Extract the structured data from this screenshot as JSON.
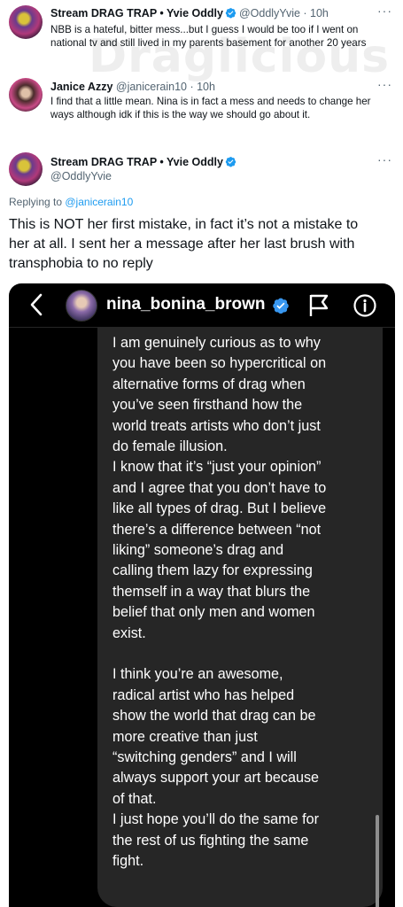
{
  "watermark": "Draglicious",
  "tweet1": {
    "name": "Stream DRAG TRAP • Yvie Oddly",
    "handle": "@OddlyYvie · 10h",
    "text_line1": "NBB is a hateful, bitter mess...but I guess I would be too if I went on",
    "text_line2": "national tv and still lived in my parents basement for another 20 years",
    "more": "···"
  },
  "tweet2": {
    "name": "Janice Azzy",
    "handle": "@janicerain10 · 10h",
    "text_line1": "I find that a little mean. Nina is in fact a mess and needs to change her",
    "text_line2": "ways although idk if this is the way we should go about it.",
    "more": "···"
  },
  "tweet3": {
    "name": "Stream DRAG TRAP • Yvie Oddly",
    "handle": "@OddlyYvie",
    "more": "···",
    "replying_prefix": "Replying to ",
    "replying_handle": "@janicerain10",
    "text_line1": "This is NOT her first mistake, in fact it’s not a mistake to",
    "text_line2": "her at all. I sent her a message after her last brush with",
    "text_line3": "transphobia to no reply"
  },
  "instagram": {
    "username": "nina_bonina_brown",
    "message_lines": [
      "I am genuinely curious as to why",
      "you have been so hypercritical on",
      "alternative forms of drag when",
      "you’ve seen firsthand how the",
      "world treats artists who don’t just",
      "do female illusion.",
      "I know that it’s “just your opinion”",
      "and I agree that you don’t have to",
      "like all types of drag. But I believe",
      "there’s a difference between “not",
      "liking” someone’s drag and",
      "calling them lazy for expressing",
      "themself in a way that blurs the",
      "belief that only men and women",
      "exist.",
      "",
      "I think you’re an awesome,",
      "radical artist who has helped",
      "show the world that drag can be",
      "more creative than just",
      "“switching genders” and I will",
      "always support your art because",
      "of that.",
      "I just hope you’ll do the same for",
      "the rest of us fighting the same",
      "fight."
    ]
  },
  "colors": {
    "verified_blue": "#1d9bf0",
    "link_blue": "#1d9bf0",
    "secondary_text": "#536471",
    "ig_background": "#000000",
    "ig_bubble": "#262626"
  }
}
